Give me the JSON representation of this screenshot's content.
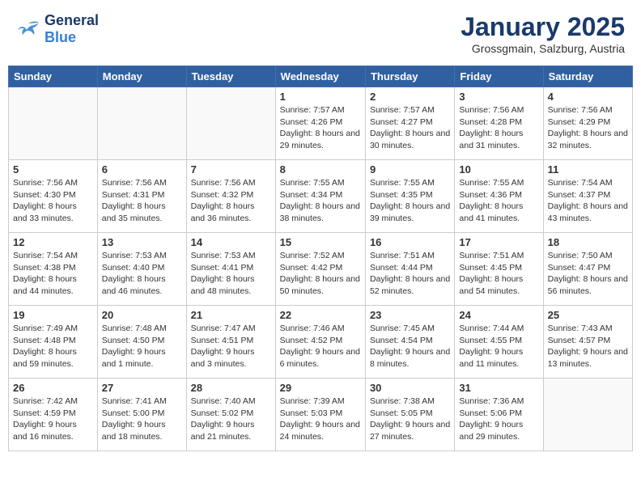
{
  "header": {
    "logo_general": "General",
    "logo_blue": "Blue",
    "month": "January 2025",
    "location": "Grossgmain, Salzburg, Austria"
  },
  "days_of_week": [
    "Sunday",
    "Monday",
    "Tuesday",
    "Wednesday",
    "Thursday",
    "Friday",
    "Saturday"
  ],
  "weeks": [
    [
      {
        "day": "",
        "info": ""
      },
      {
        "day": "",
        "info": ""
      },
      {
        "day": "",
        "info": ""
      },
      {
        "day": "1",
        "info": "Sunrise: 7:57 AM\nSunset: 4:26 PM\nDaylight: 8 hours and 29 minutes."
      },
      {
        "day": "2",
        "info": "Sunrise: 7:57 AM\nSunset: 4:27 PM\nDaylight: 8 hours and 30 minutes."
      },
      {
        "day": "3",
        "info": "Sunrise: 7:56 AM\nSunset: 4:28 PM\nDaylight: 8 hours and 31 minutes."
      },
      {
        "day": "4",
        "info": "Sunrise: 7:56 AM\nSunset: 4:29 PM\nDaylight: 8 hours and 32 minutes."
      }
    ],
    [
      {
        "day": "5",
        "info": "Sunrise: 7:56 AM\nSunset: 4:30 PM\nDaylight: 8 hours and 33 minutes."
      },
      {
        "day": "6",
        "info": "Sunrise: 7:56 AM\nSunset: 4:31 PM\nDaylight: 8 hours and 35 minutes."
      },
      {
        "day": "7",
        "info": "Sunrise: 7:56 AM\nSunset: 4:32 PM\nDaylight: 8 hours and 36 minutes."
      },
      {
        "day": "8",
        "info": "Sunrise: 7:55 AM\nSunset: 4:34 PM\nDaylight: 8 hours and 38 minutes."
      },
      {
        "day": "9",
        "info": "Sunrise: 7:55 AM\nSunset: 4:35 PM\nDaylight: 8 hours and 39 minutes."
      },
      {
        "day": "10",
        "info": "Sunrise: 7:55 AM\nSunset: 4:36 PM\nDaylight: 8 hours and 41 minutes."
      },
      {
        "day": "11",
        "info": "Sunrise: 7:54 AM\nSunset: 4:37 PM\nDaylight: 8 hours and 43 minutes."
      }
    ],
    [
      {
        "day": "12",
        "info": "Sunrise: 7:54 AM\nSunset: 4:38 PM\nDaylight: 8 hours and 44 minutes."
      },
      {
        "day": "13",
        "info": "Sunrise: 7:53 AM\nSunset: 4:40 PM\nDaylight: 8 hours and 46 minutes."
      },
      {
        "day": "14",
        "info": "Sunrise: 7:53 AM\nSunset: 4:41 PM\nDaylight: 8 hours and 48 minutes."
      },
      {
        "day": "15",
        "info": "Sunrise: 7:52 AM\nSunset: 4:42 PM\nDaylight: 8 hours and 50 minutes."
      },
      {
        "day": "16",
        "info": "Sunrise: 7:51 AM\nSunset: 4:44 PM\nDaylight: 8 hours and 52 minutes."
      },
      {
        "day": "17",
        "info": "Sunrise: 7:51 AM\nSunset: 4:45 PM\nDaylight: 8 hours and 54 minutes."
      },
      {
        "day": "18",
        "info": "Sunrise: 7:50 AM\nSunset: 4:47 PM\nDaylight: 8 hours and 56 minutes."
      }
    ],
    [
      {
        "day": "19",
        "info": "Sunrise: 7:49 AM\nSunset: 4:48 PM\nDaylight: 8 hours and 59 minutes."
      },
      {
        "day": "20",
        "info": "Sunrise: 7:48 AM\nSunset: 4:50 PM\nDaylight: 9 hours and 1 minute."
      },
      {
        "day": "21",
        "info": "Sunrise: 7:47 AM\nSunset: 4:51 PM\nDaylight: 9 hours and 3 minutes."
      },
      {
        "day": "22",
        "info": "Sunrise: 7:46 AM\nSunset: 4:52 PM\nDaylight: 9 hours and 6 minutes."
      },
      {
        "day": "23",
        "info": "Sunrise: 7:45 AM\nSunset: 4:54 PM\nDaylight: 9 hours and 8 minutes."
      },
      {
        "day": "24",
        "info": "Sunrise: 7:44 AM\nSunset: 4:55 PM\nDaylight: 9 hours and 11 minutes."
      },
      {
        "day": "25",
        "info": "Sunrise: 7:43 AM\nSunset: 4:57 PM\nDaylight: 9 hours and 13 minutes."
      }
    ],
    [
      {
        "day": "26",
        "info": "Sunrise: 7:42 AM\nSunset: 4:59 PM\nDaylight: 9 hours and 16 minutes."
      },
      {
        "day": "27",
        "info": "Sunrise: 7:41 AM\nSunset: 5:00 PM\nDaylight: 9 hours and 18 minutes."
      },
      {
        "day": "28",
        "info": "Sunrise: 7:40 AM\nSunset: 5:02 PM\nDaylight: 9 hours and 21 minutes."
      },
      {
        "day": "29",
        "info": "Sunrise: 7:39 AM\nSunset: 5:03 PM\nDaylight: 9 hours and 24 minutes."
      },
      {
        "day": "30",
        "info": "Sunrise: 7:38 AM\nSunset: 5:05 PM\nDaylight: 9 hours and 27 minutes."
      },
      {
        "day": "31",
        "info": "Sunrise: 7:36 AM\nSunset: 5:06 PM\nDaylight: 9 hours and 29 minutes."
      },
      {
        "day": "",
        "info": ""
      }
    ]
  ]
}
